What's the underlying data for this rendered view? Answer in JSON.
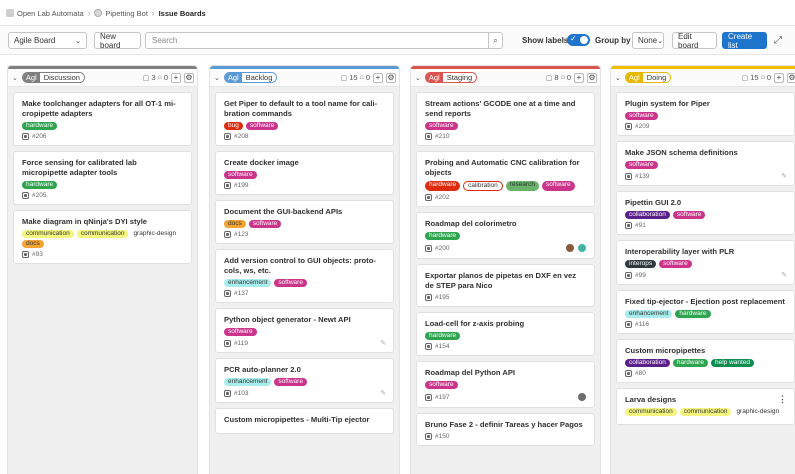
{
  "breadcrumb": {
    "group": "Open Lab Automata",
    "project": "Pipetting Bot",
    "current": "Issue Boards"
  },
  "filterbar": {
    "board_select": "Agile Board",
    "new_board": "New board",
    "search_placeholder": "Search",
    "show_labels": "Show labels",
    "show_labels_on": true,
    "group_by": "Group by",
    "group_by_value": "None",
    "edit_board": "Edit board",
    "create_list": "Create list"
  },
  "colors": {
    "primary": "#1f75cb",
    "hardware": "#2ea44f",
    "software": "#cc338b",
    "bug": "#dd2b0e",
    "docs": "#f3a432",
    "communication": "#f4f57f",
    "enhancement": "#a8eded",
    "collaboration": "#5b1f8a",
    "interops": "#2f3a3f",
    "help_wanted": "#0d8c4f",
    "research": "#69b26a",
    "calibration": "#ffffff"
  },
  "columns": [
    {
      "scope": "Agl",
      "name": "Discussion",
      "scope_color": "#7f7f7f",
      "top_color": "#7f7f7f",
      "issues": "3",
      "weight": "0",
      "cards": [
        {
          "title": "Make toolchanger adapters for all OT-1 mi-cropipette adapters",
          "labels": [
            {
              "text": "hardware",
              "bg": "#2ea44f",
              "light": false
            }
          ],
          "number": "#206",
          "extra": ""
        },
        {
          "title": "Force sensing for calibrated lab micropipette adapter tools",
          "labels": [
            {
              "text": "hardware",
              "bg": "#2ea44f",
              "light": false
            }
          ],
          "number": "#205",
          "extra": ""
        },
        {
          "title": "Make diagram in qNinja's DYI style",
          "labels": [
            {
              "text": "communication",
              "bg": "#f4f57f",
              "light": true
            },
            {
              "text": "communication",
              "bg": "#f4f57f",
              "light": true
            },
            {
              "text": "graphic-design",
              "bg": "",
              "light": true,
              "plain": true
            },
            {
              "text": "docs",
              "bg": "#f3a432",
              "light": true
            }
          ],
          "number": "#93",
          "extra": ""
        }
      ]
    },
    {
      "scope": "Agl",
      "name": "Backlog",
      "scope_color": "#5b9bd5",
      "top_color": "#5b9bd5",
      "issues": "15",
      "weight": "0",
      "cards": [
        {
          "title": "Get Piper to default to a tool name for cali-bration commands",
          "labels": [
            {
              "text": "bug",
              "bg": "#dd2b0e",
              "light": false
            },
            {
              "text": "software",
              "bg": "#cc338b",
              "light": false
            }
          ],
          "number": "#208",
          "extra": ""
        },
        {
          "title": "Create docker image",
          "labels": [
            {
              "text": "software",
              "bg": "#cc338b",
              "light": false
            }
          ],
          "number": "#199",
          "extra": ""
        },
        {
          "title": "Document the GUI-backend APIs",
          "labels": [
            {
              "text": "docs",
              "bg": "#f3a432",
              "light": true
            },
            {
              "text": "software",
              "bg": "#cc338b",
              "light": false
            }
          ],
          "number": "#123",
          "extra": ""
        },
        {
          "title": "Add version control to GUI objects: proto-cols, ws, etc.",
          "labels": [
            {
              "text": "enhancement",
              "bg": "#a8eded",
              "light": true
            },
            {
              "text": "software",
              "bg": "#cc338b",
              "light": false
            }
          ],
          "number": "#137",
          "extra": ""
        },
        {
          "title": "Python object generator - Newt API",
          "labels": [
            {
              "text": "software",
              "bg": "#cc338b",
              "light": false
            }
          ],
          "number": "#119",
          "extra": "pencil"
        },
        {
          "title": "PCR auto-planner 2.0",
          "labels": [
            {
              "text": "enhancement",
              "bg": "#a8eded",
              "light": true
            },
            {
              "text": "software",
              "bg": "#cc338b",
              "light": false
            }
          ],
          "number": "#103",
          "extra": "pencil"
        },
        {
          "title": "Custom micropipettes - Multi-Tip ejector",
          "labels": [],
          "number": "",
          "extra": ""
        }
      ]
    },
    {
      "scope": "Agl",
      "name": "Staging",
      "scope_color": "#d9534f",
      "top_color": "#d9534f",
      "issues": "8",
      "weight": "0",
      "cards": [
        {
          "title": "Stream actions' GCODE one at a time and send reports",
          "labels": [
            {
              "text": "software",
              "bg": "#cc338b",
              "light": false
            }
          ],
          "number": "#210",
          "extra": ""
        },
        {
          "title": "Probing and Automatic CNC calibration for objects",
          "labels": [
            {
              "text": "hardware",
              "bg": "#dd2b0e",
              "light": false
            },
            {
              "text": "calibration",
              "bg": "#ffffff",
              "light": true,
              "border": "#dd2b0e"
            },
            {
              "text": "research",
              "bg": "#69b26a",
              "light": true
            },
            {
              "text": "software",
              "bg": "#cc338b",
              "light": false
            }
          ],
          "number": "#202",
          "extra": ""
        },
        {
          "title": "Roadmap del colorimetro",
          "labels": [
            {
              "text": "hardware",
              "bg": "#2ea44f",
              "light": false
            }
          ],
          "number": "#200",
          "extra": "avatars2"
        },
        {
          "title": "Exportar planos de pipetas en DXF en vez de STEP para Nico",
          "labels": [],
          "number": "#195",
          "extra": ""
        },
        {
          "title": "Load-cell for z-axis probing",
          "labels": [
            {
              "text": "hardware",
              "bg": "#2ea44f",
              "light": false
            }
          ],
          "number": "#154",
          "extra": ""
        },
        {
          "title": "Roadmap del Python API",
          "labels": [
            {
              "text": "software",
              "bg": "#cc338b",
              "light": false
            }
          ],
          "number": "#197",
          "extra": "avatar1"
        },
        {
          "title": "Bruno Fase 2 - definir Tareas y hacer Pagos",
          "labels": [],
          "number": "#150",
          "extra": ""
        }
      ]
    },
    {
      "scope": "Agl",
      "name": "Doing",
      "scope_color": "#e6b800",
      "top_color": "#f0c000",
      "issues": "15",
      "weight": "0",
      "cards": [
        {
          "title": "Plugin system for Piper",
          "labels": [
            {
              "text": "software",
              "bg": "#cc338b",
              "light": false
            }
          ],
          "number": "#209",
          "extra": ""
        },
        {
          "title": "Make JSON schema definitions",
          "labels": [
            {
              "text": "software",
              "bg": "#cc338b",
              "light": false
            }
          ],
          "number": "#139",
          "extra": "pencil"
        },
        {
          "title": "Pipettin GUI 2.0",
          "labels": [
            {
              "text": "collaboration",
              "bg": "#5b1f8a",
              "light": false
            },
            {
              "text": "software",
              "bg": "#cc338b",
              "light": false
            }
          ],
          "number": "#91",
          "extra": ""
        },
        {
          "title": "Interoperability layer with PLR",
          "labels": [
            {
              "text": "interops",
              "bg": "#2f3a3f",
              "light": false
            },
            {
              "text": "software",
              "bg": "#cc338b",
              "light": false
            }
          ],
          "number": "#99",
          "extra": "pencil"
        },
        {
          "title": "Fixed tip-ejector - Ejection post replacement",
          "labels": [
            {
              "text": "enhancement",
              "bg": "#a8eded",
              "light": true
            },
            {
              "text": "hardware",
              "bg": "#2ea44f",
              "light": false
            }
          ],
          "number": "#116",
          "extra": ""
        },
        {
          "title": "Custom micropipettes",
          "labels": [
            {
              "text": "collaboration",
              "bg": "#5b1f8a",
              "light": false
            },
            {
              "text": "hardware",
              "bg": "#2ea44f",
              "light": false
            },
            {
              "text": "help wanted",
              "bg": "#0d8c4f",
              "light": false
            }
          ],
          "number": "#80",
          "extra": ""
        },
        {
          "title": "Larva designs",
          "labels": [
            {
              "text": "communication",
              "bg": "#f4f57f",
              "light": true
            },
            {
              "text": "communication",
              "bg": "#f4f57f",
              "light": true
            },
            {
              "text": "graphic-design",
              "bg": "",
              "light": true,
              "plain": true
            }
          ],
          "number": "",
          "extra": "kebab"
        }
      ]
    }
  ]
}
